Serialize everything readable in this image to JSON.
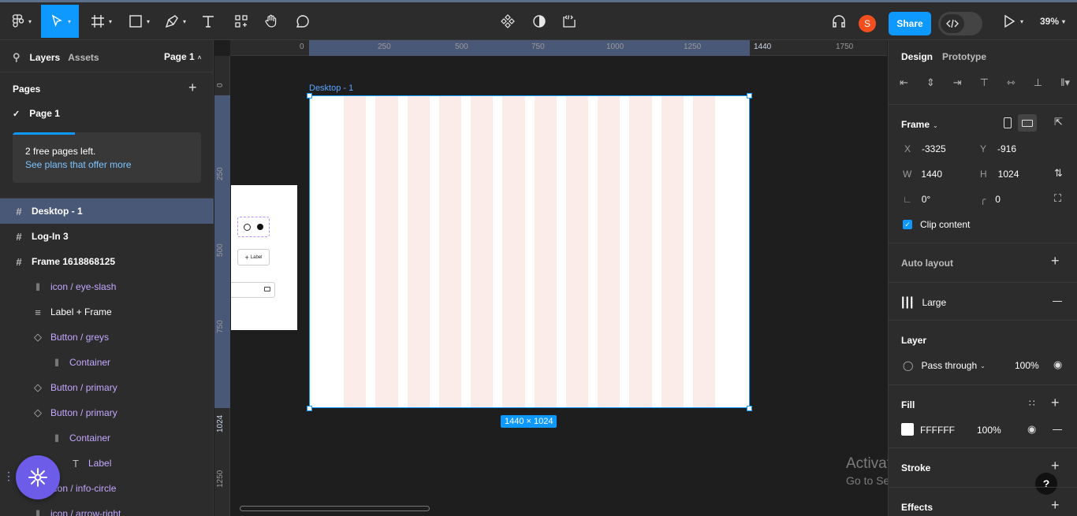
{
  "toolbar": {
    "share_label": "Share",
    "zoom": "39%",
    "avatar_initial": "S"
  },
  "left": {
    "tab_layers": "Layers",
    "tab_assets": "Assets",
    "page_selector": "Page 1",
    "pages_title": "Pages",
    "page_item": "Page 1",
    "notice_text": "2 free pages left.",
    "notice_link": "See plans that offer more",
    "layers": [
      {
        "label": "Desktop - 1",
        "icon": "frame-icon"
      },
      {
        "label": "Log-In 3",
        "icon": "frame-icon"
      },
      {
        "label": "Frame 1618868125",
        "icon": "frame-icon"
      },
      {
        "label": "icon / eye-slash",
        "icon": "column-layout-icon"
      },
      {
        "label": "Label + Frame",
        "icon": "text-lines-icon"
      },
      {
        "label": "Button / greys",
        "icon": "component-instance-icon"
      },
      {
        "label": "Container",
        "icon": "column-layout-icon"
      },
      {
        "label": "Button / primary",
        "icon": "component-instance-icon"
      },
      {
        "label": "Button / primary",
        "icon": "component-instance-icon"
      },
      {
        "label": "Container",
        "icon": "column-layout-icon"
      },
      {
        "label": "Label",
        "icon": "text-icon"
      },
      {
        "label": "icon / info-circle",
        "icon": "column-layout-icon"
      },
      {
        "label": "icon / arrow-right",
        "icon": "column-layout-icon"
      }
    ]
  },
  "canvas": {
    "frame_label": "Desktop - 1",
    "size_badge": "1440 × 1024",
    "ruler_h": [
      "0",
      "250",
      "500",
      "750",
      "1000",
      "1250",
      "1440",
      "1750"
    ],
    "ruler_v": [
      "0",
      "250",
      "500",
      "750",
      "1024",
      "1250"
    ],
    "mini_button_label": "Label",
    "watermark_title": "Activate Windows",
    "watermark_sub": "Go to Settings to activate Windows."
  },
  "right": {
    "tab_design": "Design",
    "tab_prototype": "Prototype",
    "frame_title": "Frame",
    "x_label": "X",
    "x_value": "-3325",
    "y_label": "Y",
    "y_value": "-916",
    "w_label": "W",
    "w_value": "1440",
    "h_label": "H",
    "h_value": "1024",
    "rotation": "0°",
    "radius": "0",
    "clip_content": "Clip content",
    "auto_layout": "Auto layout",
    "grid_label": "Large",
    "layer_title": "Layer",
    "blend_mode": "Pass through",
    "layer_opacity": "100%",
    "fill_title": "Fill",
    "fill_hex": "FFFFFF",
    "fill_opacity": "100%",
    "stroke_title": "Stroke",
    "effects_title": "Effects"
  },
  "colors": {
    "accent": "#0d99ff",
    "panel": "#2c2c2c",
    "canvas": "#1e1e1e",
    "selected_layer": "#4a5878",
    "column_tint": "#fbecea",
    "avatar": "#f24e1e",
    "help_fab": "#6c5ce7"
  }
}
